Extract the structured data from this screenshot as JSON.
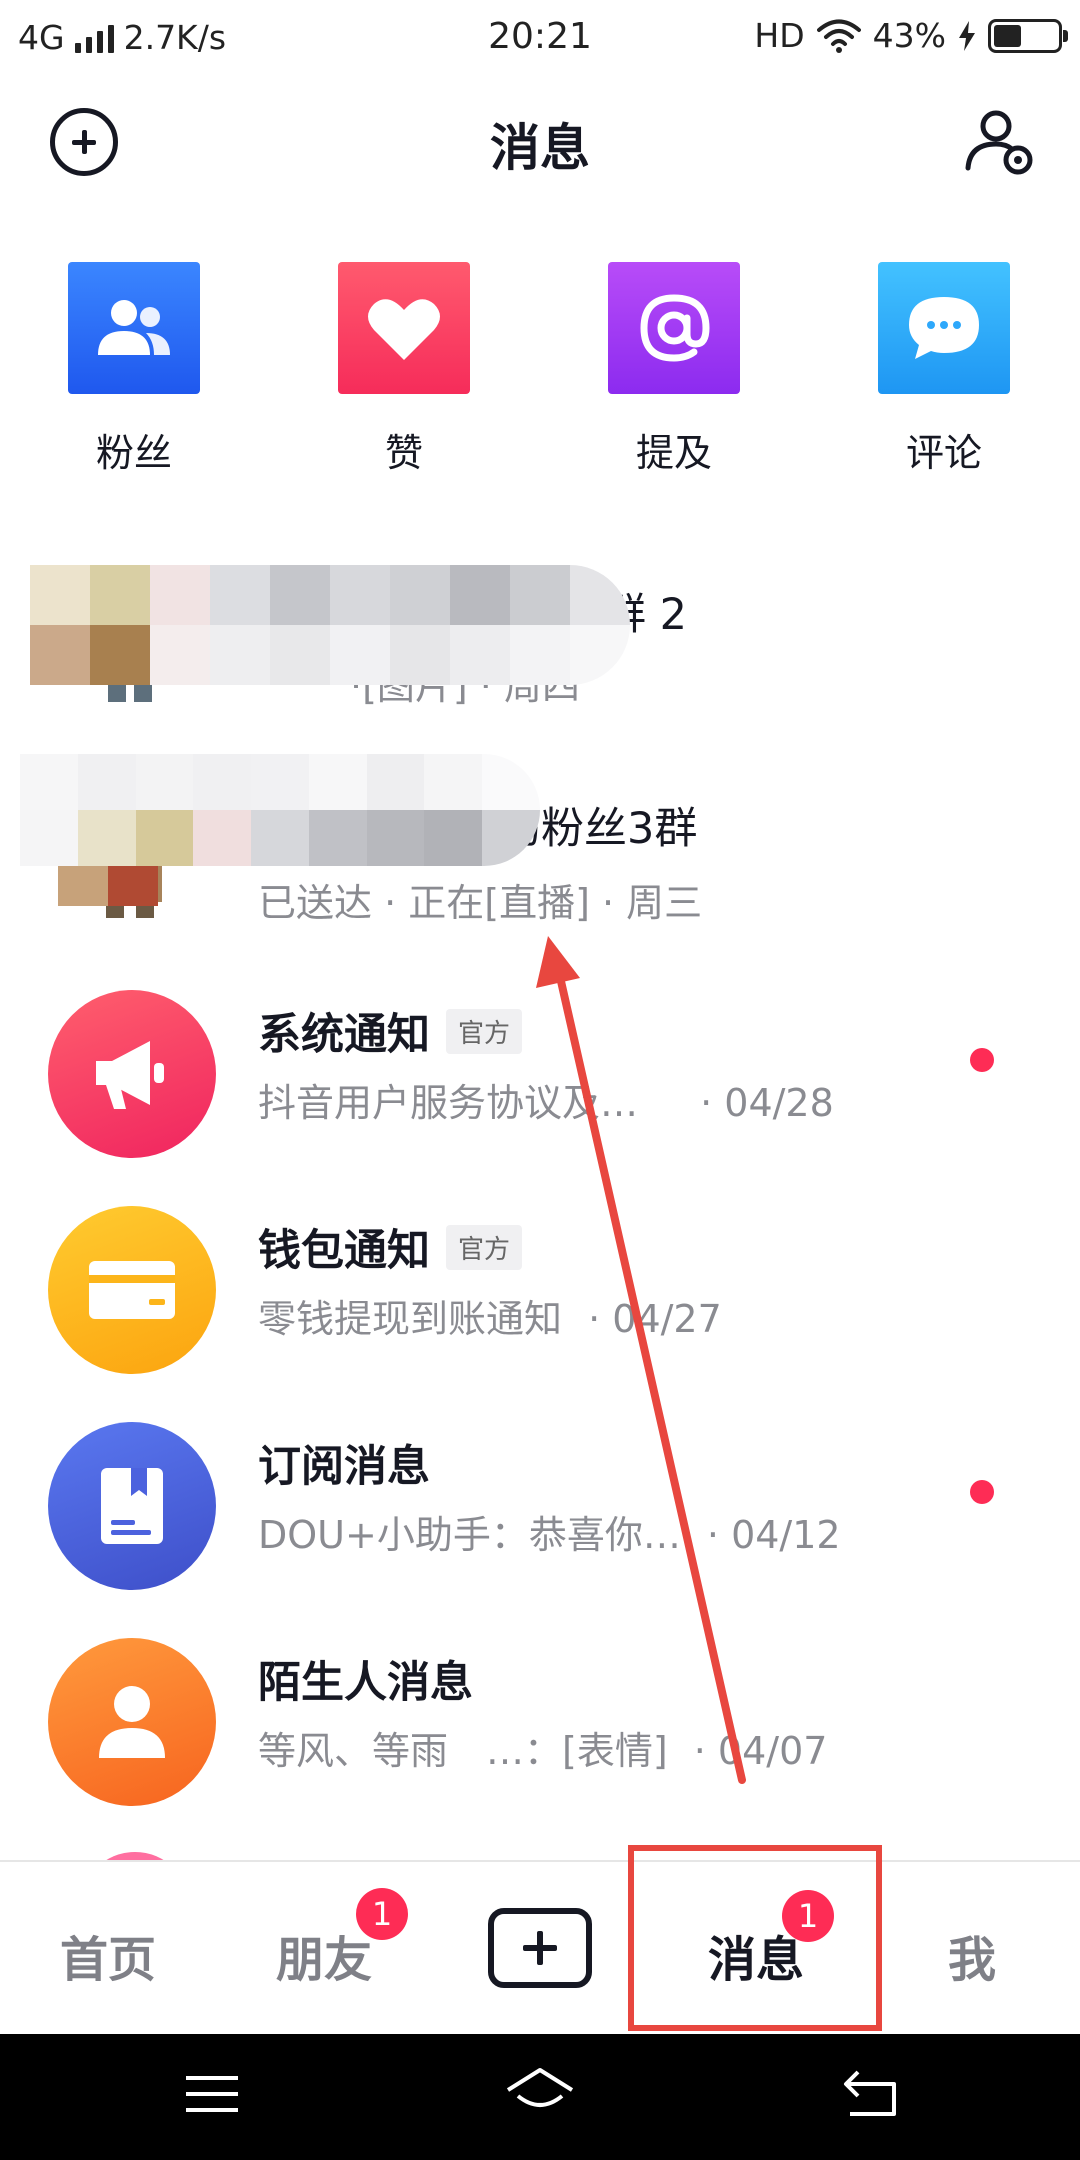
{
  "status_bar": {
    "network": "4G",
    "speed": "2.7K/s",
    "time": "20:21",
    "hd": "HD",
    "battery_text": "43%",
    "battery_level": 0.43
  },
  "header": {
    "title": "消息"
  },
  "quick_entries": [
    {
      "label": "粉丝",
      "icon": "fans-icon",
      "color": "#2f6ef6"
    },
    {
      "label": "赞",
      "icon": "heart-icon",
      "color": "#fa3a63"
    },
    {
      "label": "提及",
      "icon": "at-icon",
      "color": "#a23cf4"
    },
    {
      "label": "评论",
      "icon": "comment-icon",
      "color": "#2ea8fb"
    }
  ],
  "messages": [
    {
      "title": "丝群 2",
      "subtitle": "·[图片] · 周四",
      "blurred": true
    },
    {
      "title": "的粉丝3群",
      "subtitle": "已送达 · 正在[直播] · 周三",
      "blurred": true
    },
    {
      "title": "系统通知",
      "tag": "官方",
      "subtitle": "抖音用户服务协议及…",
      "time": "· 04/28",
      "unread": true,
      "icon": "megaphone-icon",
      "color": "#f53a62"
    },
    {
      "title": "钱包通知",
      "tag": "官方",
      "subtitle": "零钱提现到账通知",
      "time": "· 04/27",
      "unread": false,
      "icon": "wallet-icon",
      "color": "#fdb61a"
    },
    {
      "title": "订阅消息",
      "subtitle": "DOU+小助手：恭喜你…",
      "time": "· 04/12",
      "unread": true,
      "icon": "bookmark-icon",
      "color": "#4c62de"
    },
    {
      "title": "陌生人消息",
      "subtitle": "等风、等雨　…：[表情]",
      "time": "· 04/07",
      "unread": false,
      "icon": "person-icon",
      "color": "#fb7b2f"
    }
  ],
  "tabbar": {
    "home": "首页",
    "friends": "朋友",
    "friends_badge": "1",
    "messages": "消息",
    "messages_badge": "1",
    "me": "我"
  },
  "colors": {
    "accent_red": "#fe2c55",
    "annotation_red": "#e8473f"
  }
}
